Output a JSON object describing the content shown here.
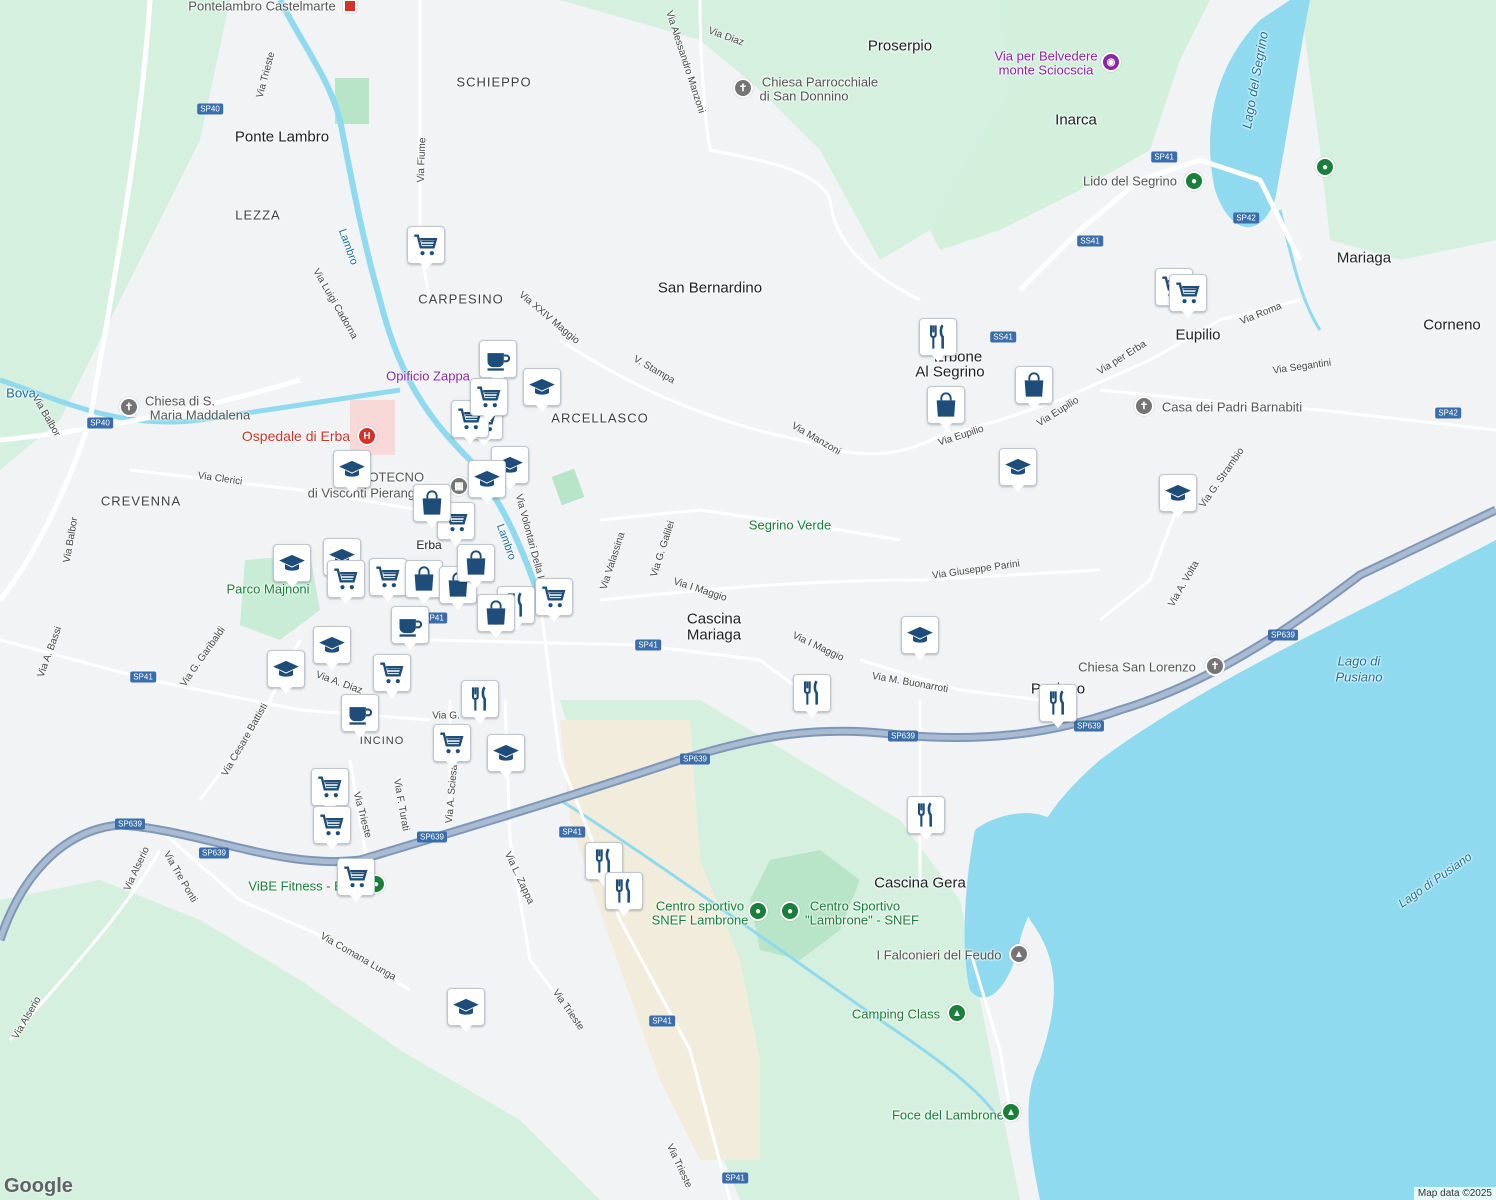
{
  "map": {
    "attribution": "Map data ©2025",
    "logo": "Google",
    "colors": {
      "background": "#f1f3f4",
      "water": "#8fdaee",
      "park": "#c8ecd6",
      "highway": "#7f97b6",
      "road": "#ffffff",
      "pin_icon": "#1e4d7a"
    },
    "labels": {
      "proserpio": "Proserpio",
      "inarca": "Inarca",
      "mariaga": "Mariaga",
      "corneno": "Corneno",
      "eupilio": "Eupilio",
      "erbone": "Erbone",
      "al_segrino": "Al Segrino",
      "san_bernardino": "San Bernardino",
      "cascina": "Cascina",
      "mariaga2": "Mariaga",
      "cascina_gera": "Cascina Gera",
      "ponte_lambro": "Ponte Lambro",
      "lezza": "LEZZA",
      "schieppo": "SCHIEPPO",
      "carpesino": "CARPESINO",
      "arcellasco": "ARCELLASCO",
      "crevenna": "CREVENNA",
      "incino": "INCINO",
      "erba": "Erba",
      "pusiano": "Pusiano",
      "pontelambro_castelmarte": "Pontelambro Castelmarte",
      "chiesa_donnino_1": "Chiesa Parrocchiale",
      "chiesa_donnino_2": "di San Donnino",
      "belvedere_1": "Via per Belvedere",
      "belvedere_2": "monte Sciocscia",
      "lido_segrino": "Lido del Segrino",
      "lago_segrino": "Lago del Segrino",
      "casa_padri": "Casa dei Padri Barnabiti",
      "segrino_verde": "Segrino Verde",
      "chiesa_lorenzo": "Chiesa San Lorenzo",
      "lago_pusiano_1": "Lago di",
      "lago_pusiano_2": "Pusiano",
      "lago_pusiano_diag": "Lago di Pusiano",
      "opificio": "Opificio Zappa",
      "chiesa_maddalena_1": "Chiesa di S.",
      "chiesa_maddalena_2": "Maria Maddalena",
      "ospedale": "Ospedale di Erba",
      "hellotecno_1": "HELLOTECNO",
      "hellotecno_2": "di Visconti Pierangelo",
      "parco_majnoni": "Parco Majnoni",
      "vibe": "ViBE Fitness - Erba",
      "snef1_1": "Centro sportivo",
      "snef1_2": "SNEF Lambrone",
      "snef2_1": "Centro Sportivo",
      "snef2_2": "\"Lambrone\" - SNEF",
      "falconieri": "I Falconieri del Feudo",
      "camping": "Camping Class",
      "foce": "Foce del Lambrone",
      "bova": "Bova",
      "lambro_1": "Lambro",
      "lambro_2": "Lambro"
    },
    "streets": {
      "via_diaz": "Via Diaz",
      "via_manzoni_a": "Via Alessandro Manzoni",
      "via_trieste_n": "Via Trieste",
      "via_fiume": "Via Fiume",
      "via_cadorna": "Via Luigi Cadorna",
      "via_xxiv": "Via XXIV Maggio",
      "v_stampa": "V. Stampa",
      "via_manzoni": "Via Manzoni",
      "via_eupilio_1": "Via Eupilio",
      "via_eupilio_2": "Via Eupilio",
      "via_per_erba": "Via per Erba",
      "via_roma": "Via Roma",
      "via_segantini": "Via Segantini",
      "via_strambio": "Via G. Strambio",
      "via_parini": "Via Giuseppe Parini",
      "via_volta": "Via A. Volta",
      "via_buonarroti": "Via M. Buonarroti",
      "via_i_maggio_1": "Via I Maggio",
      "via_i_maggio_2": "Via I Maggio",
      "via_galilei": "Via G. Galilei",
      "via_valassina": "Via Valassina",
      "via_volontari": "Via Volontari Della Libertà",
      "via_balbor": "Via Balbor",
      "via_balbor2": "Via Balbor",
      "via_clerici": "Via Clerici",
      "via_bassi": "Via A. Bassi",
      "via_garibaldi": "Via G. Garibaldi",
      "via_battisti": "Via Cesare Battisti",
      "via_diaz2": "Via A. Diaz",
      "via_turati": "Via F. Turati",
      "via_trieste_s": "Via Trieste",
      "via_sciesa": "Via A. Sciesa",
      "via_zappa": "Via L. Zappa",
      "via_trieste_s2": "Via Trieste",
      "via_trieste_s3": "Via Trieste",
      "via_alserio": "Via Alserio",
      "via_alserio2": "Via Alserio",
      "via_tre_ponti": "Via Tre Ponti",
      "via_comana": "Via Comana Lunga",
      "via_g": "Via G."
    },
    "shields": {
      "sp40_a": "SP40",
      "sp40_b": "SP40",
      "sp41_a": "SP41",
      "sp41_b": "SP41",
      "sp41_c": "SP41",
      "sp41_d": "SP41",
      "sp41_e": "SP41",
      "sp41_f": "SP41",
      "sp41_g": "SP41",
      "ss41_a": "SS41",
      "ss41_b": "SS41",
      "sp42_a": "SP42",
      "sp42_b": "SP42",
      "sp639_a": "SP639",
      "sp639_b": "SP639",
      "sp639_c": "SP639",
      "sp639_d": "SP639",
      "sp639_e": "SP639",
      "sp639_f": "SP639",
      "sp639_g": "SP639"
    },
    "pins": [
      {
        "name": "shopping-cart-icon"
      },
      {
        "name": "shopping-cart-icon"
      },
      {
        "name": "shopping-cart-icon"
      },
      {
        "name": "coffee-cup-icon"
      },
      {
        "name": "graduation-cap-icon"
      },
      {
        "name": "shopping-cart-icon"
      },
      {
        "name": "graduation-cap-icon"
      },
      {
        "name": "graduation-cap-icon"
      },
      {
        "name": "graduation-cap-icon"
      },
      {
        "name": "shopping-cart-icon"
      },
      {
        "name": "shopping-bag-icon"
      },
      {
        "name": "graduation-cap-icon"
      },
      {
        "name": "graduation-cap-icon"
      },
      {
        "name": "shopping-cart-icon"
      },
      {
        "name": "shopping-cart-icon"
      },
      {
        "name": "shopping-bag-icon"
      },
      {
        "name": "shopping-bag-icon"
      },
      {
        "name": "shopping-bag-icon"
      },
      {
        "name": "shopping-cart-icon"
      },
      {
        "name": "fork-knife-icon"
      },
      {
        "name": "shopping-bag-icon"
      },
      {
        "name": "coffee-cup-icon"
      },
      {
        "name": "graduation-cap-icon"
      },
      {
        "name": "graduation-cap-icon"
      },
      {
        "name": "shopping-cart-icon"
      },
      {
        "name": "coffee-cup-icon"
      },
      {
        "name": "fork-knife-icon"
      },
      {
        "name": "shopping-cart-icon"
      },
      {
        "name": "graduation-cap-icon"
      },
      {
        "name": "shopping-cart-icon"
      },
      {
        "name": "shopping-cart-icon"
      },
      {
        "name": "shopping-cart-icon"
      },
      {
        "name": "fork-knife-icon"
      },
      {
        "name": "fork-knife-icon"
      },
      {
        "name": "graduation-cap-icon"
      },
      {
        "name": "fork-knife-icon"
      },
      {
        "name": "shopping-bag-icon"
      },
      {
        "name": "shopping-bag-icon"
      },
      {
        "name": "graduation-cap-icon"
      },
      {
        "name": "shopping-cart-icon"
      },
      {
        "name": "shopping-cart-icon"
      },
      {
        "name": "graduation-cap-icon"
      },
      {
        "name": "graduation-cap-icon"
      },
      {
        "name": "fork-knife-icon"
      },
      {
        "name": "fork-knife-icon"
      },
      {
        "name": "fork-knife-icon"
      }
    ]
  }
}
